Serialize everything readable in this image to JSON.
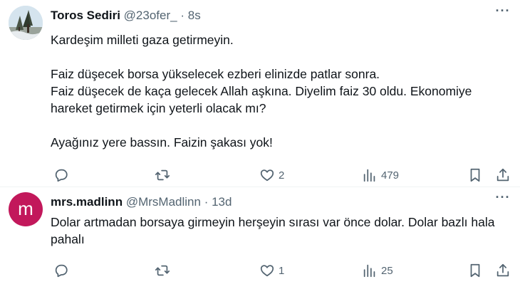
{
  "tweets": [
    {
      "author_name": "Toros Sediri",
      "handle": "@23ofer_",
      "separator": "·",
      "time": "8s",
      "more_label": "···",
      "text": "Kardeşim milleti gaza getirmeyin.\n\nFaiz düşecek borsa yükselecek ezberi elinizde patlar sonra.\nFaiz düşecek de kaça gelecek Allah aşkına.  Diyelim faiz 30 oldu. Ekonomiye hareket getirmek için yeterli olacak mı?\n\nAyağınız yere bassın.  Faizin şakası yok!",
      "likes": "2",
      "views": "479",
      "avatar_icon": "tree-photo-avatar"
    },
    {
      "author_name": "mrs.madlinn",
      "handle": "@MrsMadlinn",
      "separator": "·",
      "time": "13d",
      "more_label": "···",
      "text": "Dolar artmadan borsaya girmeyin herşeyin sırası var önce dolar. Dolar bazlı hala pahalı",
      "likes": "1",
      "views": "25",
      "avatar_letter": "m",
      "avatar_color": "#c2185b"
    }
  ],
  "icons": {
    "reply": "reply-icon",
    "retweet": "retweet-icon",
    "like": "heart-icon",
    "views": "views-icon",
    "bookmark": "bookmark-icon",
    "share": "share-icon"
  },
  "colors": {
    "text": "#0f1419",
    "secondary": "#536471",
    "divider": "#eff3f4"
  }
}
